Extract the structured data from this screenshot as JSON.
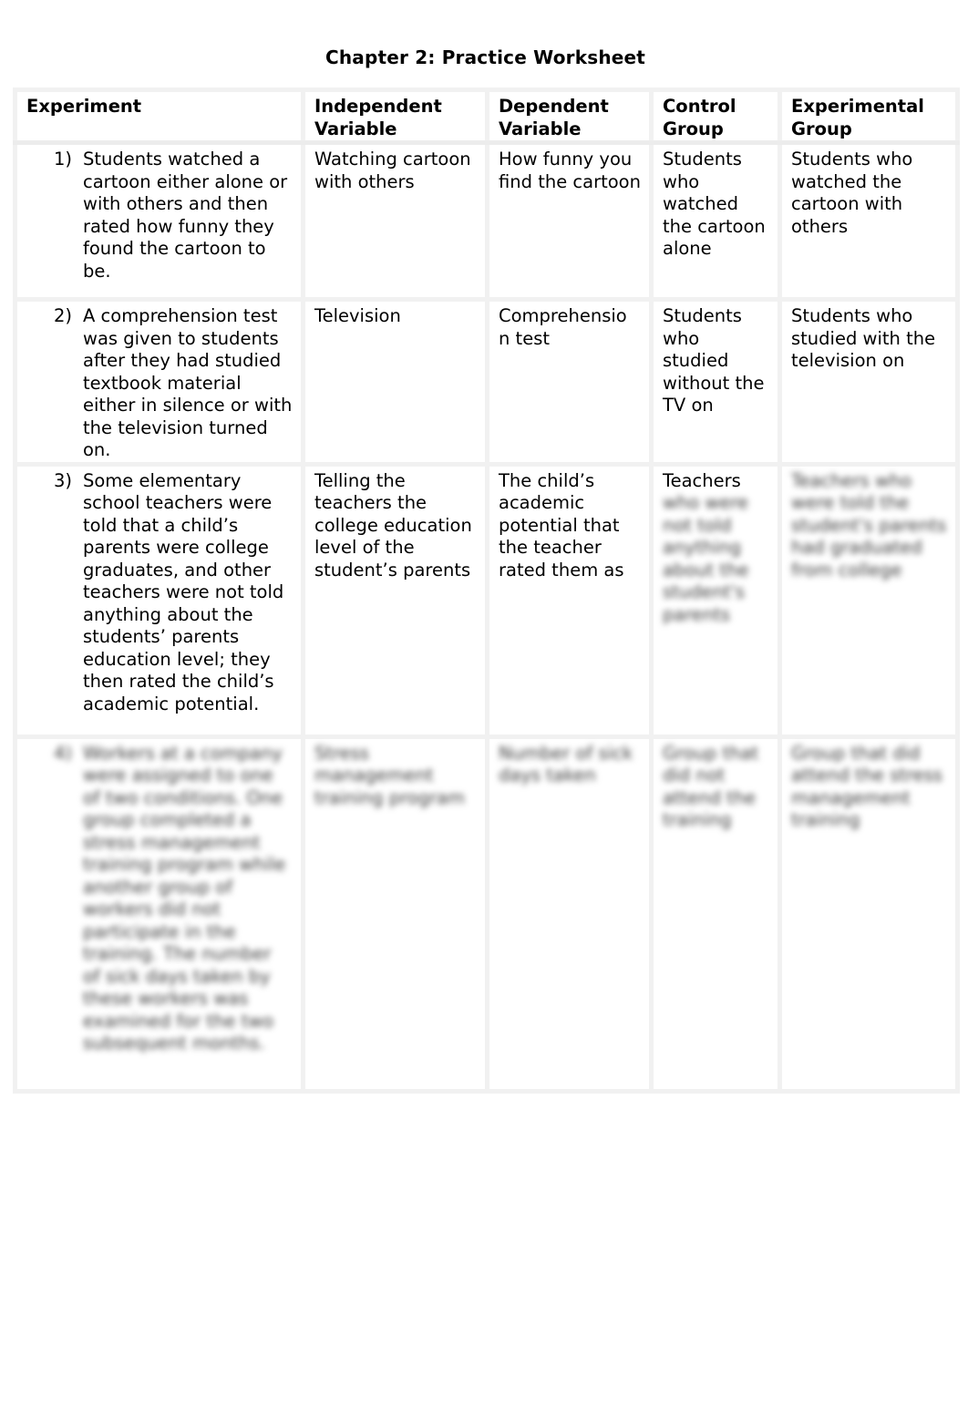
{
  "document": {
    "title": "Chapter 2: Practice Worksheet"
  },
  "table": {
    "headers": [
      "Experiment",
      "Independent Variable",
      "Dependent Variable",
      "Control Group",
      "Experimental Group"
    ],
    "header_lines": {
      "experiment": "Experiment",
      "iv_1": "Independent",
      "iv_2": "Variable",
      "dv_1": "Dependent",
      "dv_2": "Variable",
      "cg_1": "Control",
      "cg_2": "Group",
      "eg_1": "Experimental",
      "eg_2": "Group"
    },
    "rows": [
      {
        "number": "1)",
        "experiment": "Students watched a cartoon either alone or with others and then rated how funny they found the cartoon to be.",
        "independent_variable": "Watching cartoon with others",
        "dependent_variable": "How funny you find the cartoon",
        "control_group": "Students who watched the cartoon alone",
        "experimental_group": "Students who watched the cartoon with others"
      },
      {
        "number": "2)",
        "experiment": "A comprehension test was given to students after they had studied textbook material either in silence or with the television turned on.",
        "independent_variable": "Television",
        "dependent_variable": "Comprehensio n test",
        "control_group": "Students who studied without the TV on",
        "experimental_group": "Students who studied with the television on"
      },
      {
        "number": "3)",
        "experiment": "Some elementary school teachers were told that a child’s parents were college graduates, and other teachers were not told anything about the students’ parents education level; they then rated the child’s academic potential.",
        "independent_variable": "Telling the teachers the college education level of the student’s parents",
        "dependent_variable": "The child’s academic potential that the teacher rated them as",
        "control_group": "Teachers",
        "control_group_obscured": "who were not told anything about the student's parents",
        "experimental_group_obscured": "Teachers who were told the student's parents had graduated from college"
      },
      {
        "number_obscured": "4)",
        "experiment_obscured": "Workers at a company were assigned to one of two conditions. One group completed a stress management training program while another group of workers did not participate in the training. The number of sick days taken by these workers was examined for the two subsequent months.",
        "independent_variable_obscured": "Stress management training program",
        "dependent_variable_obscured": "Number of sick days taken",
        "control_group_obscured": "Group that did not attend the training",
        "experimental_group_obscured": "Group that did attend the stress management training"
      }
    ]
  }
}
